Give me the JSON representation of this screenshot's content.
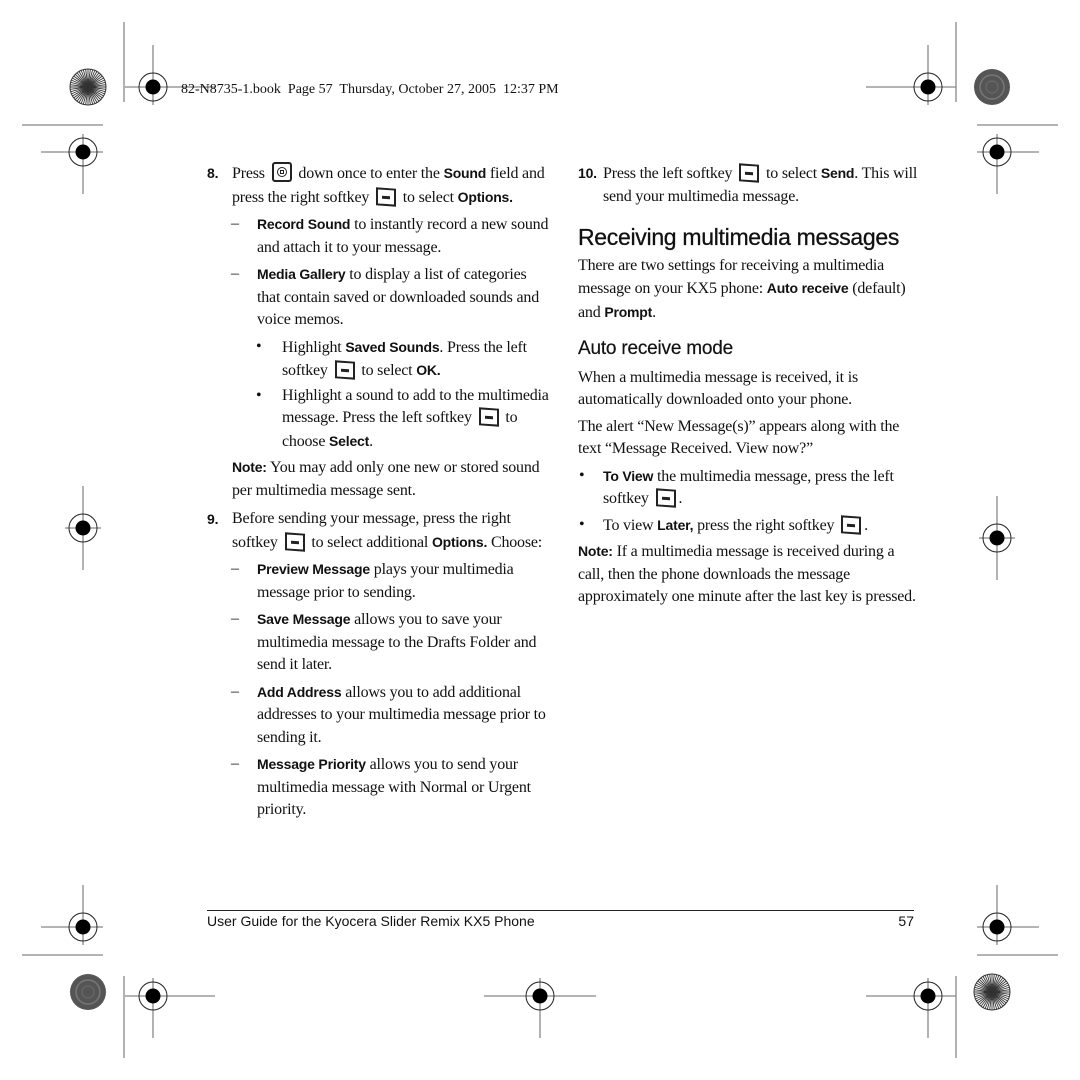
{
  "header": {
    "book_info": "82-N8735-1.book  Page 57  Thursday, October 27, 2005  12:37 PM"
  },
  "left_column": {
    "step8": {
      "number": "8.",
      "t1": "Press",
      "t2": " down once to enter the ",
      "b1": "Sound",
      "t3": " field and press the right softkey",
      "t4": " to select ",
      "b2": "Options.",
      "subitems": [
        {
          "marker": "–",
          "bold": "Record Sound",
          "text": " to instantly record a new sound and attach it to your message."
        },
        {
          "marker": "–",
          "bold": "Media Gallery",
          "text": " to display a list of categories that contain saved or downloaded sounds and voice memos."
        }
      ],
      "bullets": {
        "b1_t1": "Highlight ",
        "b1_bold": "Saved Sounds",
        "b1_t2": ". Press the left softkey",
        "b1_t3": " to select ",
        "b1_bold2": "OK.",
        "b2_t1": "Highlight a sound to add to the multimedia message. Press the left softkey",
        "b2_t2": " to choose ",
        "b2_bold": "Select",
        "b2_t3": "."
      },
      "note_label": "Note:",
      "note_text": "  You may add only one new or stored sound per multimedia message sent."
    },
    "step9": {
      "number": "9.",
      "t1": "Before sending your message, press the right softkey",
      "t2": " to select additional ",
      "b1": "Options.",
      "t3": " Choose:",
      "subitems": [
        {
          "marker": "–",
          "bold": "Preview Message",
          "text": " plays your multimedia message prior to sending."
        },
        {
          "marker": "–",
          "bold": "Save Message",
          "text": " allows you to save your multimedia message to the Drafts Folder and send it later."
        },
        {
          "marker": "–",
          "bold": "Add Address",
          "text": " allows you to add additional addresses to your multimedia message prior to sending it."
        },
        {
          "marker": "–",
          "bold": "Message Priority",
          "text": " allows you to send your multimedia message with Normal or Urgent priority."
        }
      ]
    }
  },
  "right_column": {
    "step10": {
      "number": "10.",
      "t1": "Press the left softkey",
      "t2": " to select ",
      "b1": "Send",
      "t3": ". This will send your multimedia message."
    },
    "section_title": "Receiving multimedia messages",
    "intro": {
      "t1": "There are two settings for receiving a multimedia message on your KX5 phone: ",
      "b1": "Auto receive",
      "t2": " (default) and ",
      "b2": "Prompt",
      "t3": "."
    },
    "subsection_title": "Auto receive mode",
    "para1": "When a multimedia message is received, it is automatically downloaded onto your phone.",
    "para2": "The alert “New Message(s)” appears along with the text “Message Received. View now?”",
    "bullets": [
      {
        "marker": "•",
        "t0": "",
        "bold": "To View",
        "t1": " the multimedia message, press the left softkey",
        "t2": "."
      },
      {
        "marker": "•",
        "t0": "To view ",
        "bold": "Later,",
        "t1": " press the right softkey",
        "t2": "."
      }
    ],
    "note_label": "Note:",
    "note_text": "  If a multimedia message is received during a call, then the phone downloads the message approximately one minute after the last key is pressed."
  },
  "footer": {
    "guide_title": "User Guide for the Kyocera Slider Remix KX5 Phone",
    "page_number": "57"
  },
  "icons": {
    "softkey": "softkey-icon",
    "navigation_key": "navigation-key-icon",
    "registration_mark": "registration-crosshair-icon",
    "color_bar_starburst": "starburst-target-icon",
    "color_bar_solid": "gray-dot-target-icon"
  }
}
